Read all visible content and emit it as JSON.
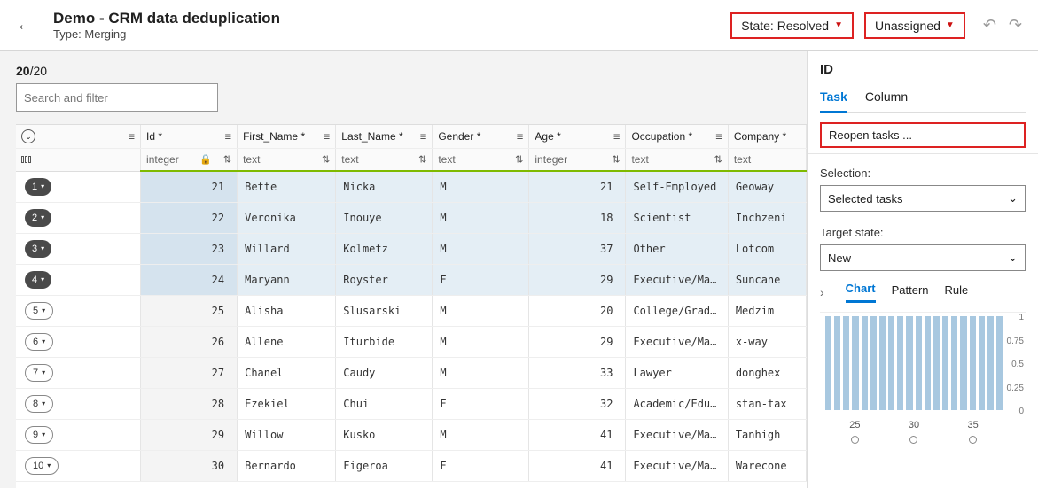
{
  "header": {
    "title": "Demo - CRM data deduplication",
    "subtitle_label": "Type:",
    "subtitle_value": "Merging",
    "state_label": "State: Resolved",
    "assign_label": "Unassigned"
  },
  "count": {
    "shown": "20",
    "total": "/20"
  },
  "filter_placeholder": "Search and filter",
  "columns": [
    {
      "key": "id",
      "label": "Id *",
      "type": "integer"
    },
    {
      "key": "fn",
      "label": "First_Name *",
      "type": "text"
    },
    {
      "key": "ln",
      "label": "Last_Name *",
      "type": "text"
    },
    {
      "key": "g",
      "label": "Gender *",
      "type": "text"
    },
    {
      "key": "age",
      "label": "Age *",
      "type": "integer"
    },
    {
      "key": "oc",
      "label": "Occupation *",
      "type": "text"
    },
    {
      "key": "co",
      "label": "Company *",
      "type": "text"
    }
  ],
  "rows": [
    {
      "n": "1",
      "sel": true,
      "id": "21",
      "fn": "Bette",
      "ln": "Nicka",
      "g": "M",
      "age": "21",
      "oc": "Self-Employed",
      "co": "Geoway"
    },
    {
      "n": "2",
      "sel": true,
      "id": "22",
      "fn": "Veronika",
      "ln": "Inouye",
      "g": "M",
      "age": "18",
      "oc": "Scientist",
      "co": "Inchzeni"
    },
    {
      "n": "3",
      "sel": true,
      "id": "23",
      "fn": "Willard",
      "ln": "Kolmetz",
      "g": "M",
      "age": "37",
      "oc": "Other",
      "co": "Lotcom"
    },
    {
      "n": "4",
      "sel": true,
      "id": "24",
      "fn": "Maryann",
      "ln": "Royster",
      "g": "F",
      "age": "29",
      "oc": "Executive/Man...",
      "co": "Suncane"
    },
    {
      "n": "5",
      "sel": false,
      "id": "25",
      "fn": "Alisha",
      "ln": "Slusarski",
      "g": "M",
      "age": "20",
      "oc": "College/Grad ...",
      "co": "Medzim"
    },
    {
      "n": "6",
      "sel": false,
      "id": "26",
      "fn": "Allene",
      "ln": "Iturbide",
      "g": "M",
      "age": "29",
      "oc": "Executive/Man...",
      "co": "x-way"
    },
    {
      "n": "7",
      "sel": false,
      "id": "27",
      "fn": "Chanel",
      "ln": "Caudy",
      "g": "M",
      "age": "33",
      "oc": "Lawyer",
      "co": "donghex"
    },
    {
      "n": "8",
      "sel": false,
      "id": "28",
      "fn": "Ezekiel",
      "ln": "Chui",
      "g": "F",
      "age": "32",
      "oc": "Academic/Educ...",
      "co": "stan-tax"
    },
    {
      "n": "9",
      "sel": false,
      "id": "29",
      "fn": "Willow",
      "ln": "Kusko",
      "g": "M",
      "age": "41",
      "oc": "Executive/Man...",
      "co": "Tanhigh"
    },
    {
      "n": "10",
      "sel": false,
      "id": "30",
      "fn": "Bernardo",
      "ln": "Figeroa",
      "g": "F",
      "age": "41",
      "oc": "Executive/Man...",
      "co": "Warecone"
    }
  ],
  "panel": {
    "title": "ID",
    "tabs": {
      "task": "Task",
      "column": "Column"
    },
    "reopen": "Reopen tasks ...",
    "selection_label": "Selection:",
    "selection_value": "Selected tasks",
    "target_label": "Target state:",
    "target_value": "New",
    "mini_tabs": {
      "chart": "Chart",
      "pattern": "Pattern",
      "rule": "Rule"
    }
  },
  "chart_data": {
    "type": "bar",
    "categories": [
      "21",
      "22",
      "23",
      "24",
      "25",
      "26",
      "27",
      "28",
      "29",
      "30",
      "31",
      "32",
      "33",
      "34",
      "35",
      "36",
      "37",
      "38",
      "39",
      "40"
    ],
    "values": [
      1,
      1,
      1,
      1,
      1,
      1,
      1,
      1,
      1,
      1,
      1,
      1,
      1,
      1,
      1,
      1,
      1,
      1,
      1,
      1
    ],
    "ylim": [
      0,
      1
    ],
    "y_ticks": [
      "1",
      "0.75",
      "0.5",
      "0.25",
      "0"
    ],
    "x_ticks_shown": [
      "25",
      "30",
      "35"
    ],
    "bar_color": "#a8c8e0"
  }
}
